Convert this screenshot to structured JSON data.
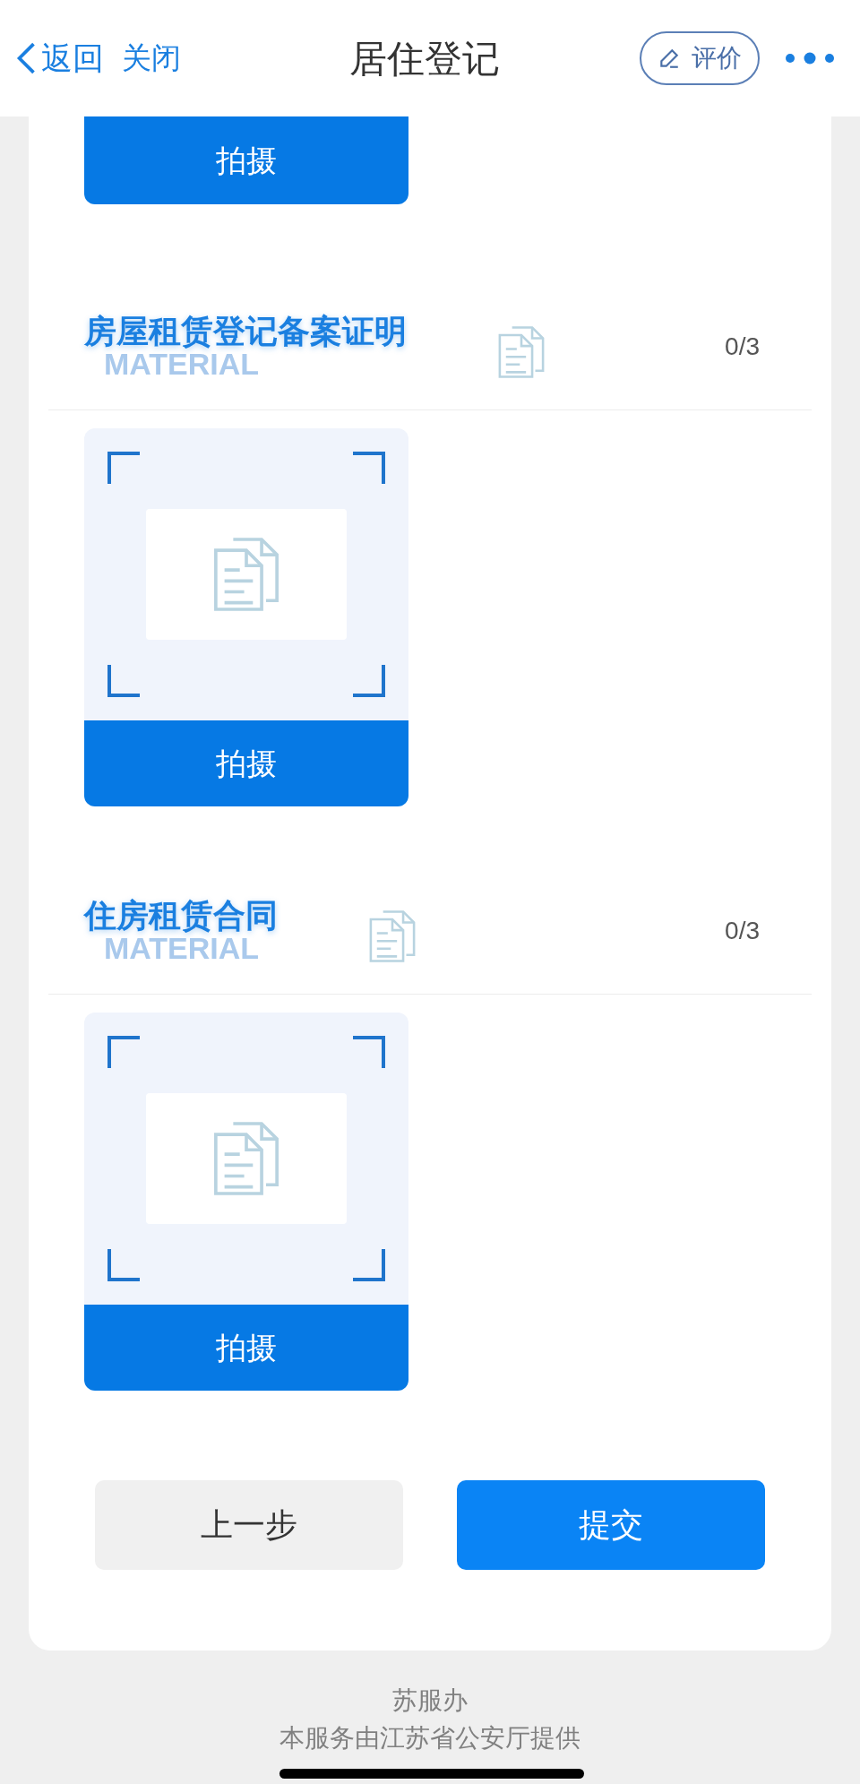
{
  "header": {
    "back": "返回",
    "close": "关闭",
    "title": "居住登记",
    "rate": "评价"
  },
  "top_button": "拍摄",
  "sections": [
    {
      "title": "房屋租赁登记备案证明",
      "watermark": "MATERIAL",
      "count": "0/3",
      "button": "拍摄"
    },
    {
      "title": "住房租赁合同",
      "watermark": "MATERIAL",
      "count": "0/3",
      "button": "拍摄"
    }
  ],
  "actions": {
    "prev": "上一步",
    "submit": "提交"
  },
  "footer": [
    "苏服办",
    "本服务由江苏省公安厅提供"
  ]
}
